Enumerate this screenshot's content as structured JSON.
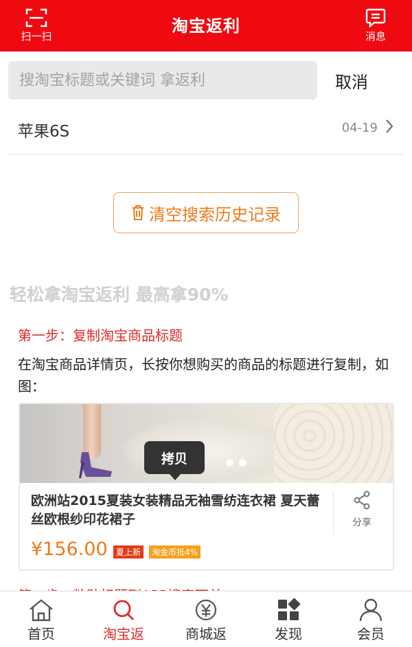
{
  "header": {
    "title": "淘宝返利",
    "scan_label": "扫一扫",
    "message_label": "消息"
  },
  "search": {
    "placeholder": "搜淘宝标题或关键词 拿返利",
    "cancel_label": "取消"
  },
  "history": {
    "items": [
      {
        "term": "苹果6S",
        "date": "04-19"
      }
    ],
    "clear_label": "清空搜索历史记录"
  },
  "guide": {
    "heading": "轻松拿淘宝返利 最高拿90%",
    "step1_title": "第一步：复制淘宝商品标题",
    "step1_desc": "在淘宝商品详情页，长按你想购买的商品的标题进行复制，如图：",
    "example": {
      "copy_tip": "拷贝",
      "product_title": "欧洲站2015夏装女装精品无袖雪纺连衣裙 夏天蕾丝欧根纱印花裙子",
      "share_label": "分享",
      "price": "¥156.00",
      "badge_new": "夏上新",
      "badge_coupon": "淘金币抵4%"
    },
    "step2_title": "第二步：粘贴标题到APP搜索下单"
  },
  "tabbar": {
    "items": [
      {
        "label": "首页",
        "icon": "home-icon"
      },
      {
        "label": "淘宝返",
        "icon": "search-icon"
      },
      {
        "label": "商城返",
        "icon": "yen-coin-icon"
      },
      {
        "label": "发现",
        "icon": "grid-icon"
      },
      {
        "label": "会员",
        "icon": "person-icon"
      }
    ],
    "active_index": 1
  },
  "colors": {
    "brand_red": "#ee0a10",
    "accent_orange": "#f07a18",
    "step_red": "#e0282a"
  }
}
